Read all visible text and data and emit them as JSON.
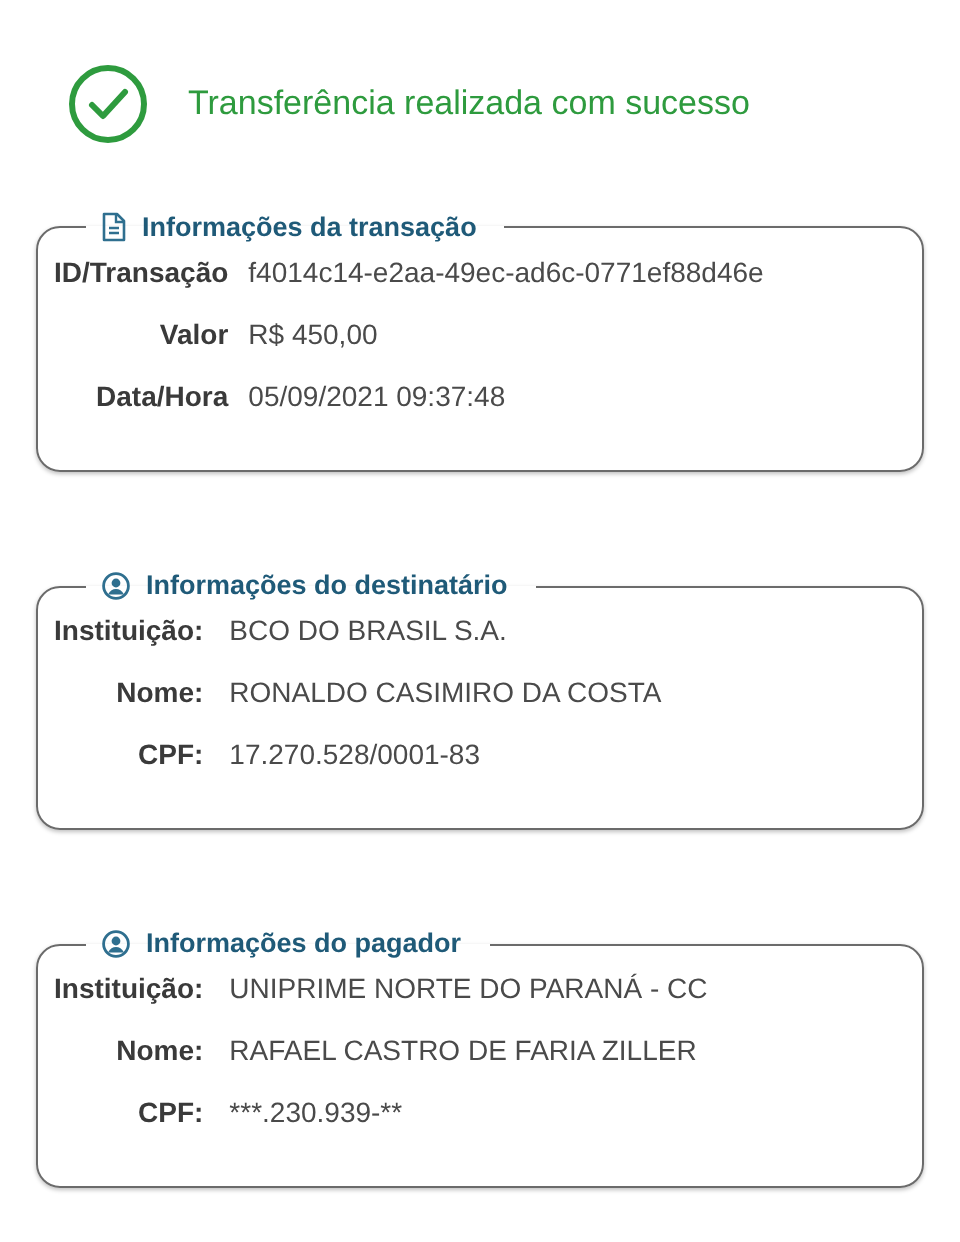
{
  "status": {
    "kind": "success",
    "message": "Transferência realizada com sucesso"
  },
  "sections": [
    {
      "title": "Informações da transação",
      "kind": "transaction",
      "fields": [
        {
          "label": "ID/Transação",
          "value": "f4014c14-e2aa-49ec-ad6c-0771ef88d46e"
        },
        {
          "label": "Valor",
          "value": "R$ 450,00"
        },
        {
          "label": "Data/Hora",
          "value": "05/09/2021 09:37:48"
        }
      ]
    },
    {
      "title": "Informações do destinatário",
      "kind": "party",
      "fields": [
        {
          "label": "Instituição:",
          "value": "BCO DO BRASIL S.A."
        },
        {
          "label": "Nome:",
          "value": "RONALDO CASIMIRO DA COSTA"
        },
        {
          "label": "CPF:",
          "value": "17.270.528/0001-83"
        }
      ]
    },
    {
      "title": "Informações do pagador",
      "kind": "party",
      "fields": [
        {
          "label": "Instituição:",
          "value": "UNIPRIME NORTE DO PARANÁ - CC"
        },
        {
          "label": "Nome:",
          "value": "RAFAEL CASTRO DE FARIA ZILLER"
        },
        {
          "label": "CPF:",
          "value": "***.230.939-**"
        }
      ]
    }
  ]
}
